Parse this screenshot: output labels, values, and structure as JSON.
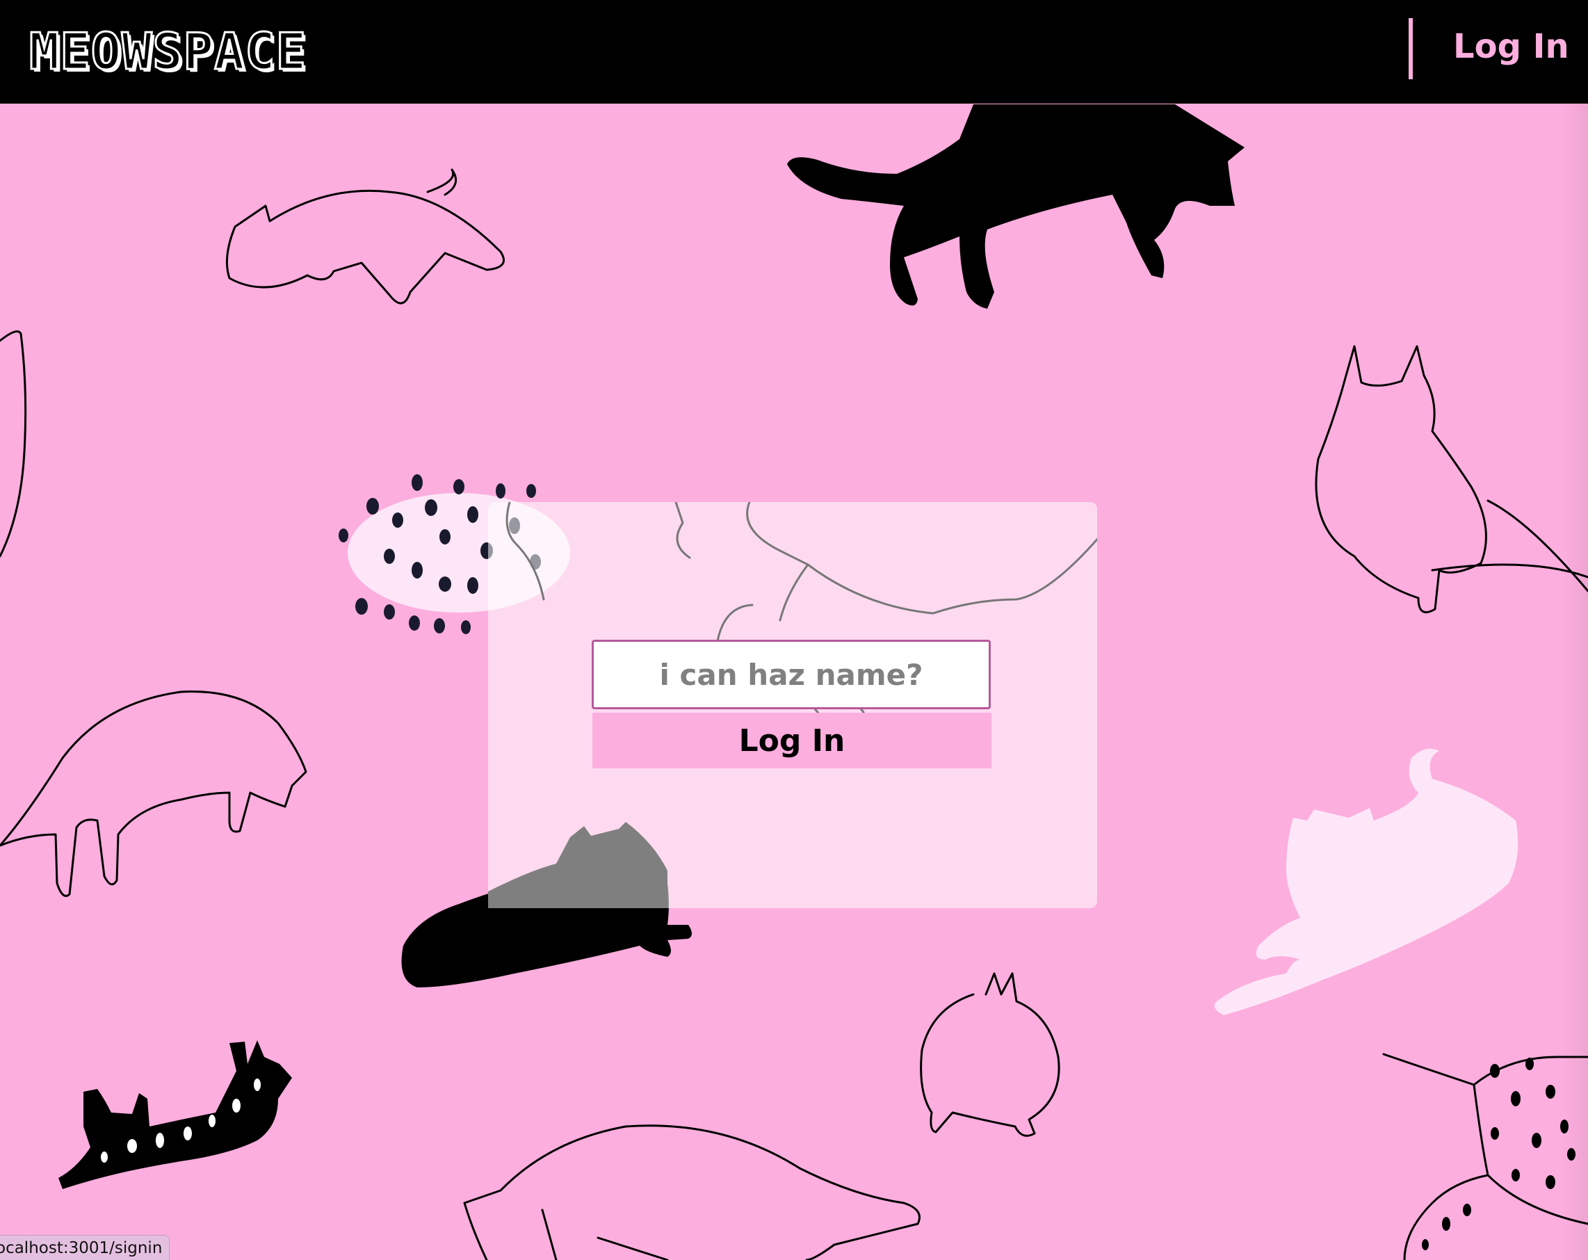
{
  "header": {
    "logo_text": "MEOWSPACE",
    "nav_login_label": "Log In"
  },
  "login_form": {
    "name_placeholder": "i can haz name?",
    "name_value": "",
    "submit_label": "Log In"
  },
  "status_bar": {
    "url": "ocalhost:3001/signin"
  },
  "colors": {
    "background_pink": "#fcaede",
    "header_black": "#000000",
    "accent_pink": "#fcaede",
    "card_overlay": "#ffffff"
  },
  "icons": [
    "cat-illustration"
  ]
}
